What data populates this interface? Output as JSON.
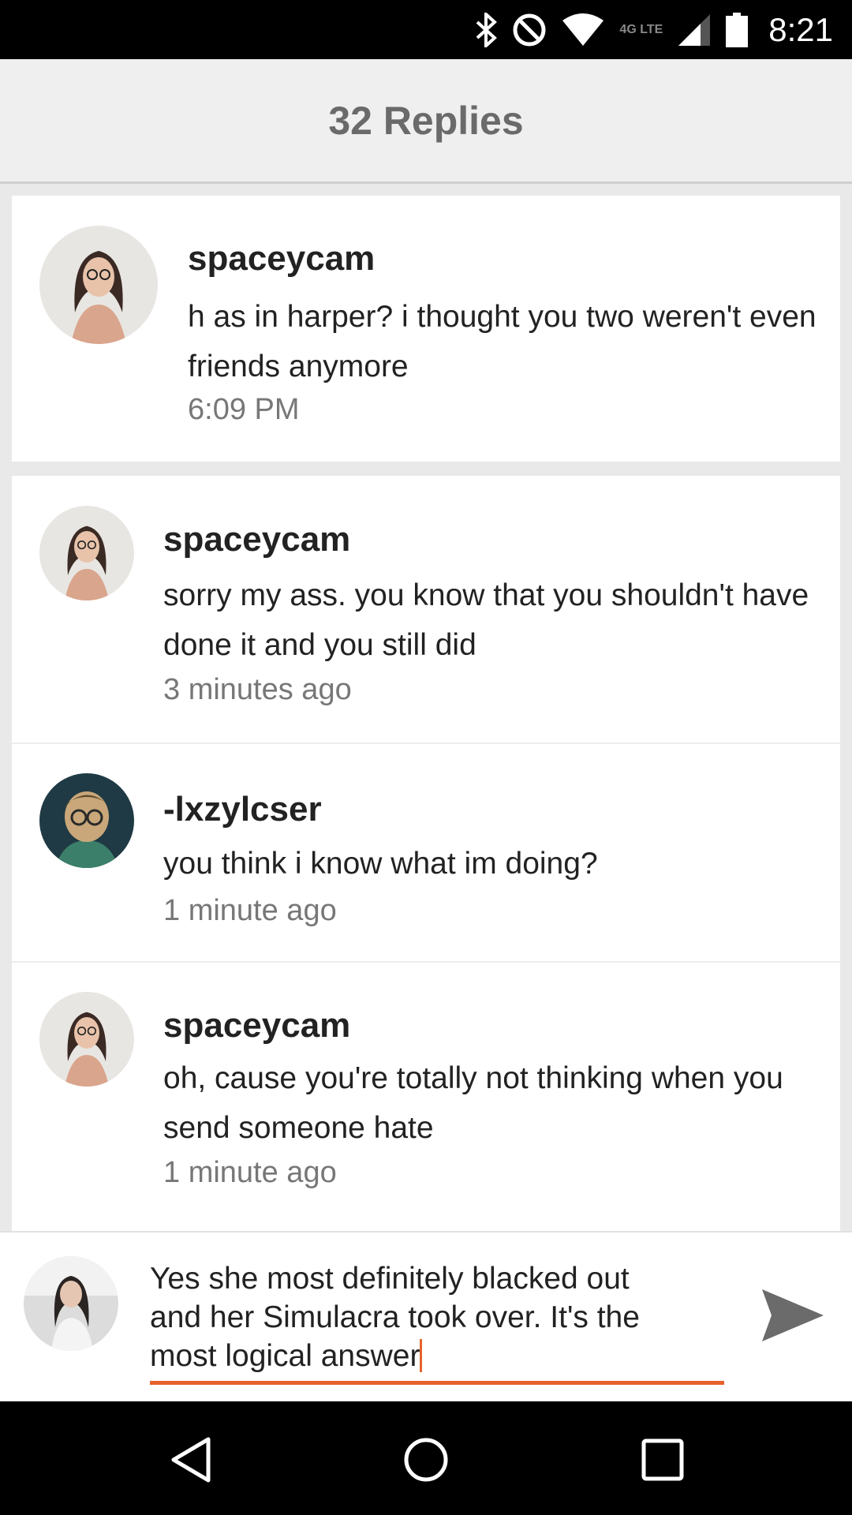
{
  "status_bar": {
    "time": "8:21",
    "network_label": "4G LTE"
  },
  "header": {
    "title": "32 Replies"
  },
  "parent_comment": {
    "username": "spaceycam",
    "message": "h as in harper? i thought you two weren't even friends anymore",
    "time": "6:09 PM"
  },
  "replies": [
    {
      "username": "spaceycam",
      "message": "sorry my ass. you know that you shouldn't have done it and you still did",
      "time": "3 minutes ago"
    },
    {
      "username": "-lxzylcser",
      "message": "you think i know what im doing?",
      "time": "1 minute ago"
    },
    {
      "username": "spaceycam",
      "message": "oh, cause you're totally not thinking when you send someone hate",
      "time": "1 minute ago"
    }
  ],
  "composer": {
    "text": "Yes she most definitely blacked out\nand her Simulacra took over. It's the\nmost logical answer"
  },
  "colors": {
    "accent": "#e8622c",
    "header_bg": "#efefef",
    "title": "#6a6a6a"
  },
  "icons": [
    "bluetooth-icon",
    "do-not-disturb-icon",
    "wifi-icon",
    "signal-icon",
    "battery-icon",
    "send-icon",
    "back-icon",
    "home-icon",
    "recents-icon"
  ]
}
